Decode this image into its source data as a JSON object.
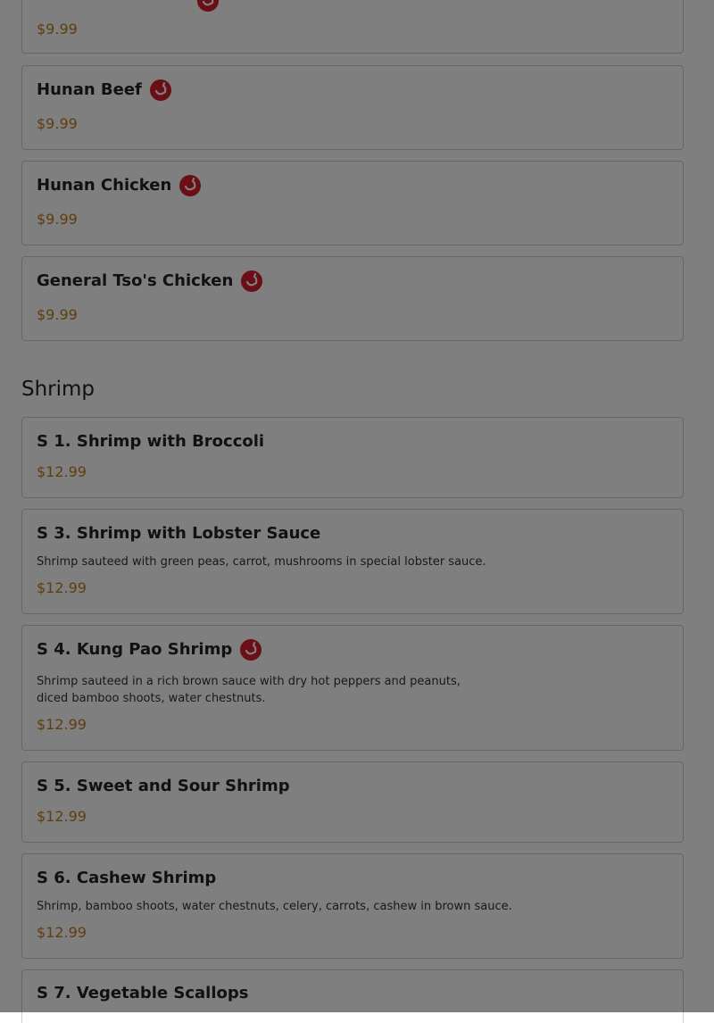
{
  "top_partial": {
    "price": "$9.99"
  },
  "items_top": [
    {
      "name": "Hunan Beef",
      "price": "$9.99",
      "spicy": true
    },
    {
      "name": "Hunan Chicken",
      "price": "$9.99",
      "spicy": true
    },
    {
      "name": "General Tso's Chicken",
      "price": "$9.99",
      "spicy": true
    }
  ],
  "shrimp_section": {
    "title": "Shrimp",
    "items": [
      {
        "name": "S 1. Shrimp with Broccoli",
        "price": "$12.99",
        "spicy": false,
        "description": ""
      },
      {
        "name": "S 3. Shrimp with Lobster Sauce",
        "price": "$12.99",
        "spicy": false,
        "description": "Shrimp sauteed with green peas, carrot, mushrooms in special lobster sauce."
      },
      {
        "name": "S 4. Kung Pao Shrimp",
        "price": "$12.99",
        "spicy": true,
        "description_line1": "Shrimp sauteed in a rich brown sauce with dry hot peppers and peanuts,",
        "description_line2": "diced bamboo shoots, water chestnuts."
      },
      {
        "name": "S 5. Sweet and Sour Shrimp",
        "price": "$12.99",
        "spicy": false,
        "description": ""
      },
      {
        "name": "S 6. Cashew Shrimp",
        "price": "$12.99",
        "spicy": false,
        "description": "Shrimp, bamboo shoots, water chestnuts, celery, carrots, cashew in brown sauce."
      },
      {
        "name": "S 7. Vegetable Scallops",
        "price": "",
        "spicy": false,
        "description": ""
      }
    ]
  },
  "colors": {
    "price": "#c07a1a",
    "spicy_icon": "#d21f2b",
    "overlay": "rgba(0,0,0,0.5)"
  },
  "icons": {
    "spicy": "chili-pepper-icon"
  }
}
